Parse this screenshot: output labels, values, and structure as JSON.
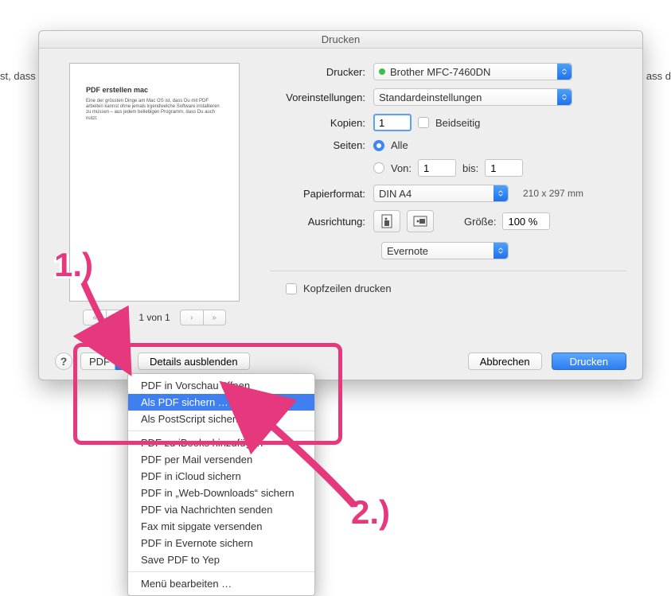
{
  "bg_left": "st, dass",
  "bg_right": "ass d",
  "dialog": {
    "title": "Drucken",
    "preview": {
      "title": "PDF erstellen mac",
      "text": "Eine der grössten Dinge am Mac OS ist, dass Du mit PDF arbeiten kannst ohne jemals irgendwelche Software installieren zu müssen – aus jedem beliebigen Programm, dass Du auch nutzt."
    },
    "pager": {
      "label": "1 von 1"
    },
    "labels": {
      "printer": "Drucker:",
      "preset": "Voreinstellungen:",
      "copies": "Kopien:",
      "twosided": "Beidseitig",
      "pages": "Seiten:",
      "all": "Alle",
      "from": "Von:",
      "to": "bis:",
      "paper": "Papierformat:",
      "orient": "Ausrichtung:",
      "size": "Größe:",
      "printheads": "Kopfzeilen drucken"
    },
    "values": {
      "printer": "Brother MFC-7460DN",
      "preset": "Standardeinstellungen",
      "copies": "1",
      "from": "1",
      "to": "1",
      "paper": "DIN A4",
      "paper_dim": "210 x 297 mm",
      "size": "100 %",
      "app": "Evernote"
    },
    "footer": {
      "pdf": "PDF",
      "details": "Details ausblenden",
      "cancel": "Abbrechen",
      "print": "Drucken"
    }
  },
  "menu": {
    "items": [
      "PDF in Vorschau öffnen",
      "Als PDF sichern …",
      "Als PostScript sichern",
      "PDF zu iBooks hinzufügen",
      "PDF per Mail versenden",
      "PDF in iCloud sichern",
      "PDF in „Web-Downloads“ sichern",
      "PDF via Nachrichten senden",
      "Fax mit sipgate versenden",
      "PDF in Evernote sichern",
      "Save PDF to Yep",
      "Menü bearbeiten …"
    ]
  },
  "callouts": {
    "one": "1.)",
    "two": "2.)"
  }
}
